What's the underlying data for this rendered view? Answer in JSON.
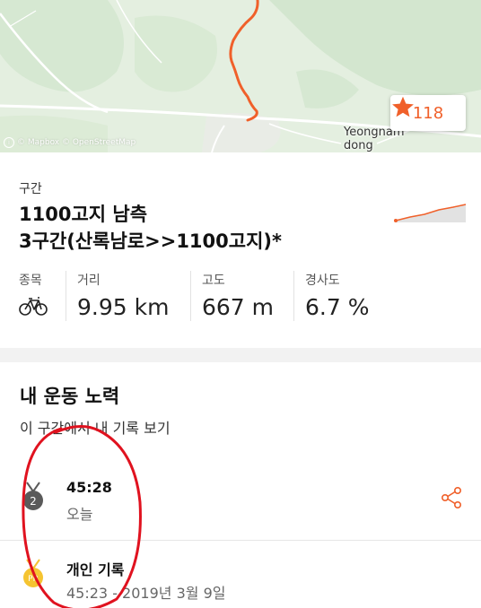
{
  "map": {
    "attribution": "© Mapbox © OpenStreetMap",
    "place_name_line1": "Yeongnam",
    "place_name_line2": "dong",
    "star_count": "118",
    "route_color": "#f0602a"
  },
  "segment": {
    "label": "구간",
    "title_line1": "1100고지 남측",
    "title_line2": "3구간(산록남로>>1100고지)*",
    "stats": {
      "type_label": "종목",
      "type_icon": "bicycle-icon",
      "distance_label": "거리",
      "distance_value": "9.95 km",
      "elevation_label": "고도",
      "elevation_value": "667 m",
      "grade_label": "경사도",
      "grade_value": "6.7 %"
    }
  },
  "efforts": {
    "title": "내 운동 노력",
    "link": "이 구간에서 내 기록 보기",
    "items": [
      {
        "medal": "2",
        "time": "45:28",
        "date": "오늘"
      },
      {
        "medal": "PR",
        "title": "개인 기록",
        "detail": "45:23 - 2019년 3월 9일"
      }
    ]
  },
  "colors": {
    "accent": "#f0602a",
    "medal_silver": "#5a5a5a",
    "medal_gold": "#f5c431",
    "annotation": "#e0121f"
  }
}
